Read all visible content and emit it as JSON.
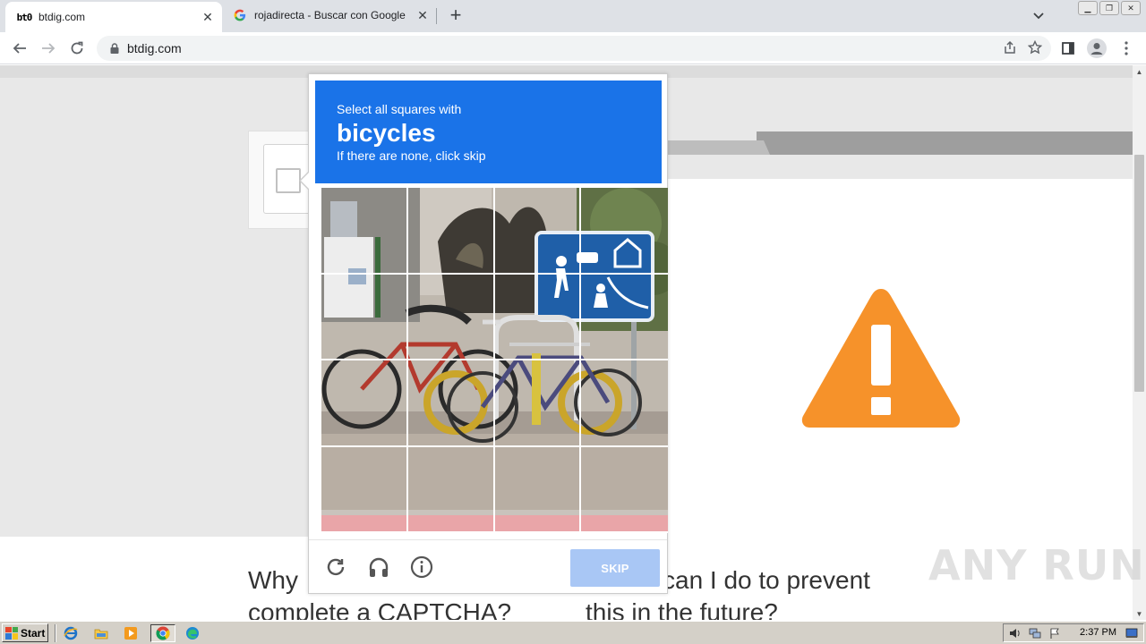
{
  "browser": {
    "tabs": [
      {
        "title": "btdig.com",
        "icon": "btdig-favicon",
        "active": true
      },
      {
        "title": "rojadirecta - Buscar con Google",
        "icon": "google-favicon",
        "active": false
      }
    ],
    "address": "btdig.com"
  },
  "page": {
    "heading_left_line1": "Why",
    "heading_left_line2": "complete a CAPTCHA?",
    "heading_right_line1": "can I do to prevent",
    "heading_right_line2": "this in the future?",
    "warning_color": "#f6922a"
  },
  "captcha": {
    "instruction": "Select all squares with",
    "target": "bicycles",
    "hint": "If there are none, click skip",
    "skip_label": "SKIP",
    "grid_rows": 4,
    "grid_cols": 4,
    "header_color": "#1a73e8",
    "skip_color": "#a9c7f5",
    "footer_icons": [
      "reload-icon",
      "audio-icon",
      "info-icon"
    ]
  },
  "watermark": "ANY RUN",
  "taskbar": {
    "start_label": "Start",
    "clock": "2:37 PM",
    "quick_launch": [
      "ie-icon",
      "explorer-icon",
      "media-player-icon",
      "chrome-icon",
      "edge-icon"
    ]
  }
}
